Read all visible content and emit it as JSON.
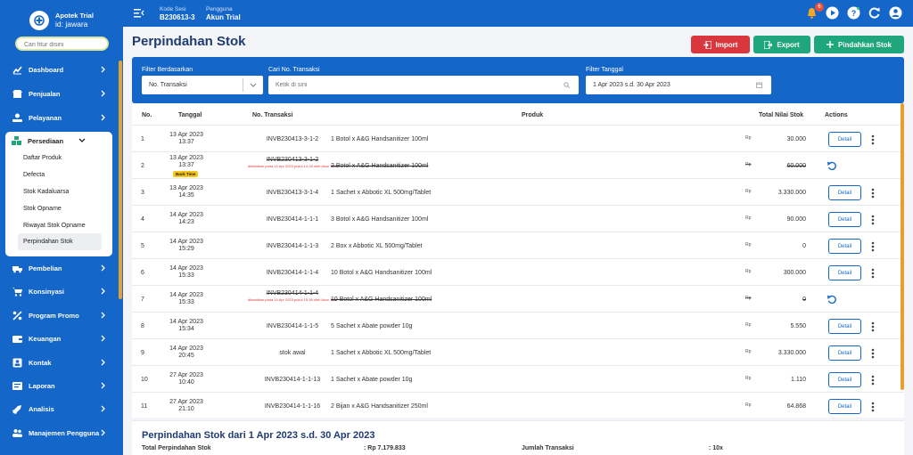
{
  "app": {
    "name": "Apotek Trial",
    "id": "id: jawara"
  },
  "sidebar": {
    "search_placeholder": "Cari fitur disini",
    "items": [
      {
        "label": "Dashboard"
      },
      {
        "label": "Penjualan"
      },
      {
        "label": "Pelayanan"
      }
    ],
    "persediaan": {
      "label": "Persediaan",
      "children": [
        "Daftar Produk",
        "Defecta",
        "Stok Kadaluarsa",
        "Stok Opname",
        "Riwayat Stok Opname",
        "Perpindahan Stok"
      ]
    },
    "items_after": [
      {
        "label": "Pembelian"
      },
      {
        "label": "Konsinyasi"
      },
      {
        "label": "Program Promo"
      },
      {
        "label": "Keuangan"
      },
      {
        "label": "Kontak"
      },
      {
        "label": "Laporan"
      },
      {
        "label": "Analisis"
      },
      {
        "label": "Manajemen Pengguna"
      }
    ]
  },
  "topbar": {
    "kode_sesi_label": "Kode Sesi",
    "kode_sesi": "B230613-3",
    "pengguna_label": "Pengguna",
    "pengguna": "Akun Trial",
    "notif_count": "6"
  },
  "page": {
    "title": "Perpindahan Stok",
    "buttons": {
      "import": "Import",
      "export": "Export",
      "pindahkan": "Pindahkan Stok"
    },
    "colors": {
      "primary": "#1466c9",
      "import": "#d9363e",
      "export": "#1fa67a",
      "pindahkan": "#1fa67a",
      "accent": "#e8a02c"
    }
  },
  "filter": {
    "by_label": "Filter Berdasarkan",
    "by_value": "No. Transaksi",
    "search_label": "Cari No. Transaksi",
    "search_placeholder": "Ketik di sini",
    "date_label": "Filter Tanggal",
    "date_value": "1 Apr 2023 s.d. 30 Apr 2023"
  },
  "table": {
    "headers": {
      "no": "No.",
      "tanggal": "Tanggal",
      "transaksi": "No. Transaksi",
      "produk": "Produk",
      "nilai": "Total Nilai Stok",
      "actions": "Actions"
    },
    "currency": "Rp",
    "detail_label": "Detail",
    "rows": [
      {
        "no": "1",
        "date": "13 Apr 2023",
        "time": "13:37",
        "tx": "INVB230413-3-1-2",
        "produk": "1 Botol x A&G Handsanitizer 100ml",
        "nilai": "30.000",
        "status": "active"
      },
      {
        "no": "2",
        "date": "13 Apr 2023",
        "time": "13:37",
        "tx": "INVB230413-3-1-2",
        "produk": "2 Botol x A&G Handsanitizer 100ml",
        "nilai": "60.000",
        "status": "cancelled",
        "note": "dibatalkan pada 14 Apr 2023 pukul 14.28 oleh Akun Trial",
        "badge": "Back Time"
      },
      {
        "no": "3",
        "date": "13 Apr 2023",
        "time": "14:35",
        "tx": "INVB230413-3-1-4",
        "produk": "1 Sachet x Abbotic XL 500mg/Tablet",
        "nilai": "3.330.000",
        "status": "active"
      },
      {
        "no": "4",
        "date": "14 Apr 2023",
        "time": "14:23",
        "tx": "INVB230414-1-1-1",
        "produk": "3 Botol x A&G Handsanitizer 100ml",
        "nilai": "90.000",
        "status": "active"
      },
      {
        "no": "5",
        "date": "14 Apr 2023",
        "time": "15:29",
        "tx": "INVB230414-1-1-3",
        "produk": "2 Box x Abbotic XL 500mg/Tablet",
        "nilai": "0",
        "status": "active"
      },
      {
        "no": "6",
        "date": "14 Apr 2023",
        "time": "15:33",
        "tx": "INVB230414-1-1-4",
        "produk": "10 Botol x A&G Handsanitizer 100ml",
        "nilai": "300.000",
        "status": "active"
      },
      {
        "no": "7",
        "date": "14 Apr 2023",
        "time": "15:33",
        "tx": "INVB230414-1-1-4",
        "produk": "10 Botol x A&G Handsanitizer 100ml",
        "nilai": "0",
        "status": "cancelled",
        "note": "dibatalkan pada 14 Apr 2023 pukul 15.36 oleh Akun Trial"
      },
      {
        "no": "8",
        "date": "14 Apr 2023",
        "time": "15:34",
        "tx": "INVB230414-1-1-5",
        "produk": "5 Sachet x Abate powder 10g",
        "nilai": "5.550",
        "status": "active"
      },
      {
        "no": "9",
        "date": "14 Apr 2023",
        "time": "20:45",
        "tx": "stok awal",
        "produk": "1 Sachet x Abbotic XL 500mg/Tablet",
        "nilai": "3.330.000",
        "status": "active"
      },
      {
        "no": "10",
        "date": "27 Apr 2023",
        "time": "10:40",
        "tx": "INVB230414-1-1-13",
        "produk": "1 Sachet x Abate powder 10g",
        "nilai": "1.110",
        "status": "active"
      },
      {
        "no": "11",
        "date": "27 Apr 2023",
        "time": "21:10",
        "tx": "INVB230414-1-1-16",
        "produk": "2 Bijan x A&G Handsanitizer 250ml",
        "nilai": "64.868",
        "status": "active"
      }
    ]
  },
  "summary": {
    "title": "Perpindahan Stok dari 1 Apr 2023 s.d. 30 Apr 2023",
    "total_label": "Total Perpindahan Stok",
    "total_value": ": Rp 7.179.833",
    "count_label": "Jumlah Transaksi",
    "count_value": ": 10x"
  }
}
